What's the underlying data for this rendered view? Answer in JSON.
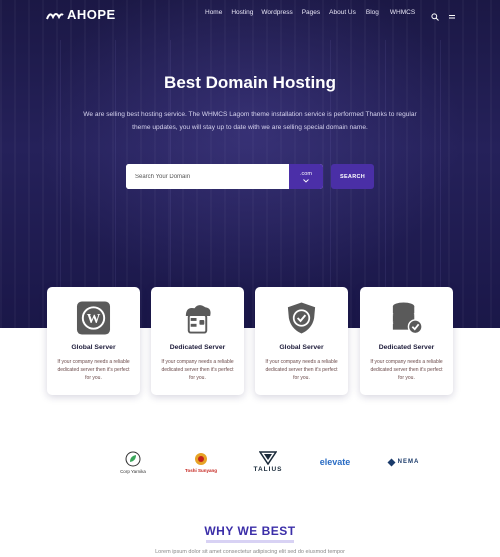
{
  "brand": {
    "name": "AHOPE",
    "logo_icon": "wave-logo-icon"
  },
  "nav": {
    "items": [
      {
        "label": "Home"
      },
      {
        "label": "Hosting"
      },
      {
        "label": "Wordpress"
      },
      {
        "label": "Pages"
      },
      {
        "label": "About Us"
      },
      {
        "label": "Blog"
      },
      {
        "label": "WHMCS"
      }
    ],
    "icons": [
      "search-icon",
      "menu-icon"
    ]
  },
  "hero": {
    "title": "Best Domain Hosting",
    "description": "We are selling best hosting service. The WHMCS Lagom theme installation service is performed Thanks to regular theme updates, you will stay up to date with we are selling special domain name."
  },
  "search": {
    "placeholder": "Search Your Domain",
    "tld_value": ".com",
    "button_label": "SEARCH"
  },
  "cards": [
    {
      "icon": "wordpress-icon",
      "title": "Global Server",
      "desc": "If your company needs a reliable dedicated server then it's perfect for you."
    },
    {
      "icon": "server-lock-icon",
      "title": "Dedicated Server",
      "desc": "If your company needs a reliable dedicated server then it's perfect for you."
    },
    {
      "icon": "shield-check-icon",
      "title": "Global Server",
      "desc": "If your company needs a reliable dedicated server then it's perfect for you."
    },
    {
      "icon": "database-check-icon",
      "title": "Dedicated Server",
      "desc": "If your company needs a reliable dedicated server then it's perfect for you."
    }
  ],
  "brands": [
    {
      "icon": "leaf-icon",
      "name": "Corp Yarnika"
    },
    {
      "icon": "badge-icon",
      "name": "Toshi Sunyang"
    },
    {
      "icon": "talius-icon",
      "name": "TALIUS"
    },
    {
      "icon": "elevate-icon",
      "name": "elevate"
    },
    {
      "icon": "nema-icon",
      "name": "NEMA"
    }
  ],
  "why": {
    "title": "WHY WE BEST",
    "description": "Lorem ipsum dolor sit amet consectetur adipiscing elit sed do eiusmod tempor"
  },
  "colors": {
    "hero_bg": "#1b1845",
    "accent": "#4a2fa6",
    "why_title": "#3b2ea8"
  }
}
